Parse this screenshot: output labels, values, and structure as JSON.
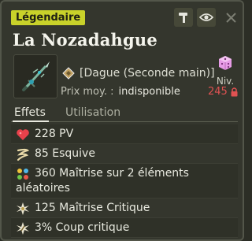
{
  "rarity": "Légendaire",
  "item": {
    "name": "La Nozadahgue",
    "type": "[Dague (Seconde main)]",
    "price_label": "Prix moy. :",
    "price_value": "indisponible",
    "level_label": "Niv.",
    "level_value": "245"
  },
  "tabs": [
    {
      "label": "Effets",
      "active": true
    },
    {
      "label": "Utilisation",
      "active": false
    }
  ],
  "effects": [
    {
      "icon": "heart-icon",
      "text": "228 PV"
    },
    {
      "icon": "dodge-icon",
      "text": "85 Esquive"
    },
    {
      "icon": "elements-icon",
      "text_line1": "360 Maîtrise sur 2 éléments",
      "text_line2": "aléatoires"
    },
    {
      "icon": "critical-mastery-icon",
      "text": "125 Maîtrise Critique"
    },
    {
      "icon": "critical-hit-icon",
      "text": "3% Coup critique"
    }
  ],
  "colors": {
    "rarity_badge": "#c9d22a",
    "level_value": "#e05252",
    "background": "#34362d"
  }
}
